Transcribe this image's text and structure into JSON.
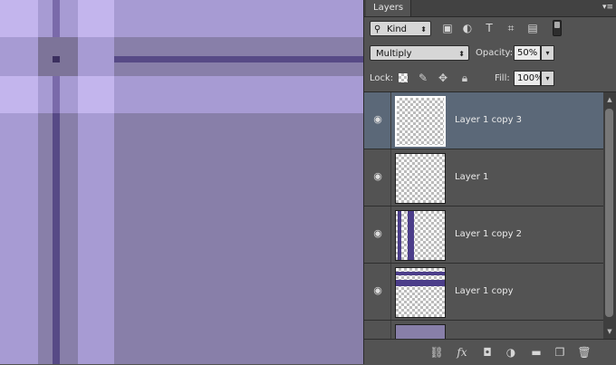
{
  "panel": {
    "tab_label": "Layers",
    "menu_icon": "panel-menu-icon"
  },
  "filter": {
    "kind_label": "Kind",
    "icons": [
      "image-filter-icon",
      "adjustment-filter-icon",
      "type-filter-icon",
      "shape-filter-icon",
      "smart-object-filter-icon"
    ],
    "type_glyph": "T"
  },
  "blending": {
    "mode": "Multiply",
    "opacity_label": "Opacity:",
    "opacity_value": "50%"
  },
  "lock": {
    "label": "Lock:",
    "fill_label": "Fill:",
    "fill_value": "100%"
  },
  "layers": [
    {
      "name": "Layer 1 copy 3",
      "selected": true,
      "visible": true
    },
    {
      "name": "Layer 1",
      "selected": false,
      "visible": true
    },
    {
      "name": "Layer 1 copy 2",
      "selected": false,
      "visible": true
    },
    {
      "name": "Layer 1 copy",
      "selected": false,
      "visible": true
    },
    {
      "name": "",
      "selected": false,
      "visible": false
    }
  ],
  "bottom_toolbar": {
    "fx_label": "fx",
    "icons": [
      "link-icon",
      "fx-icon",
      "mask-icon",
      "adjustment-icon",
      "folder-icon",
      "new-layer-icon",
      "trash-icon"
    ]
  },
  "colors": {
    "canvas_base": "#887fa9",
    "canvas_light": "#a79bd3",
    "canvas_highlight": "#c3b5ed",
    "stripe_dark": "#574a86",
    "panel_bg": "#535353",
    "selected_layer": "#5b6878",
    "thumb_stripe": "#4b3d89"
  }
}
